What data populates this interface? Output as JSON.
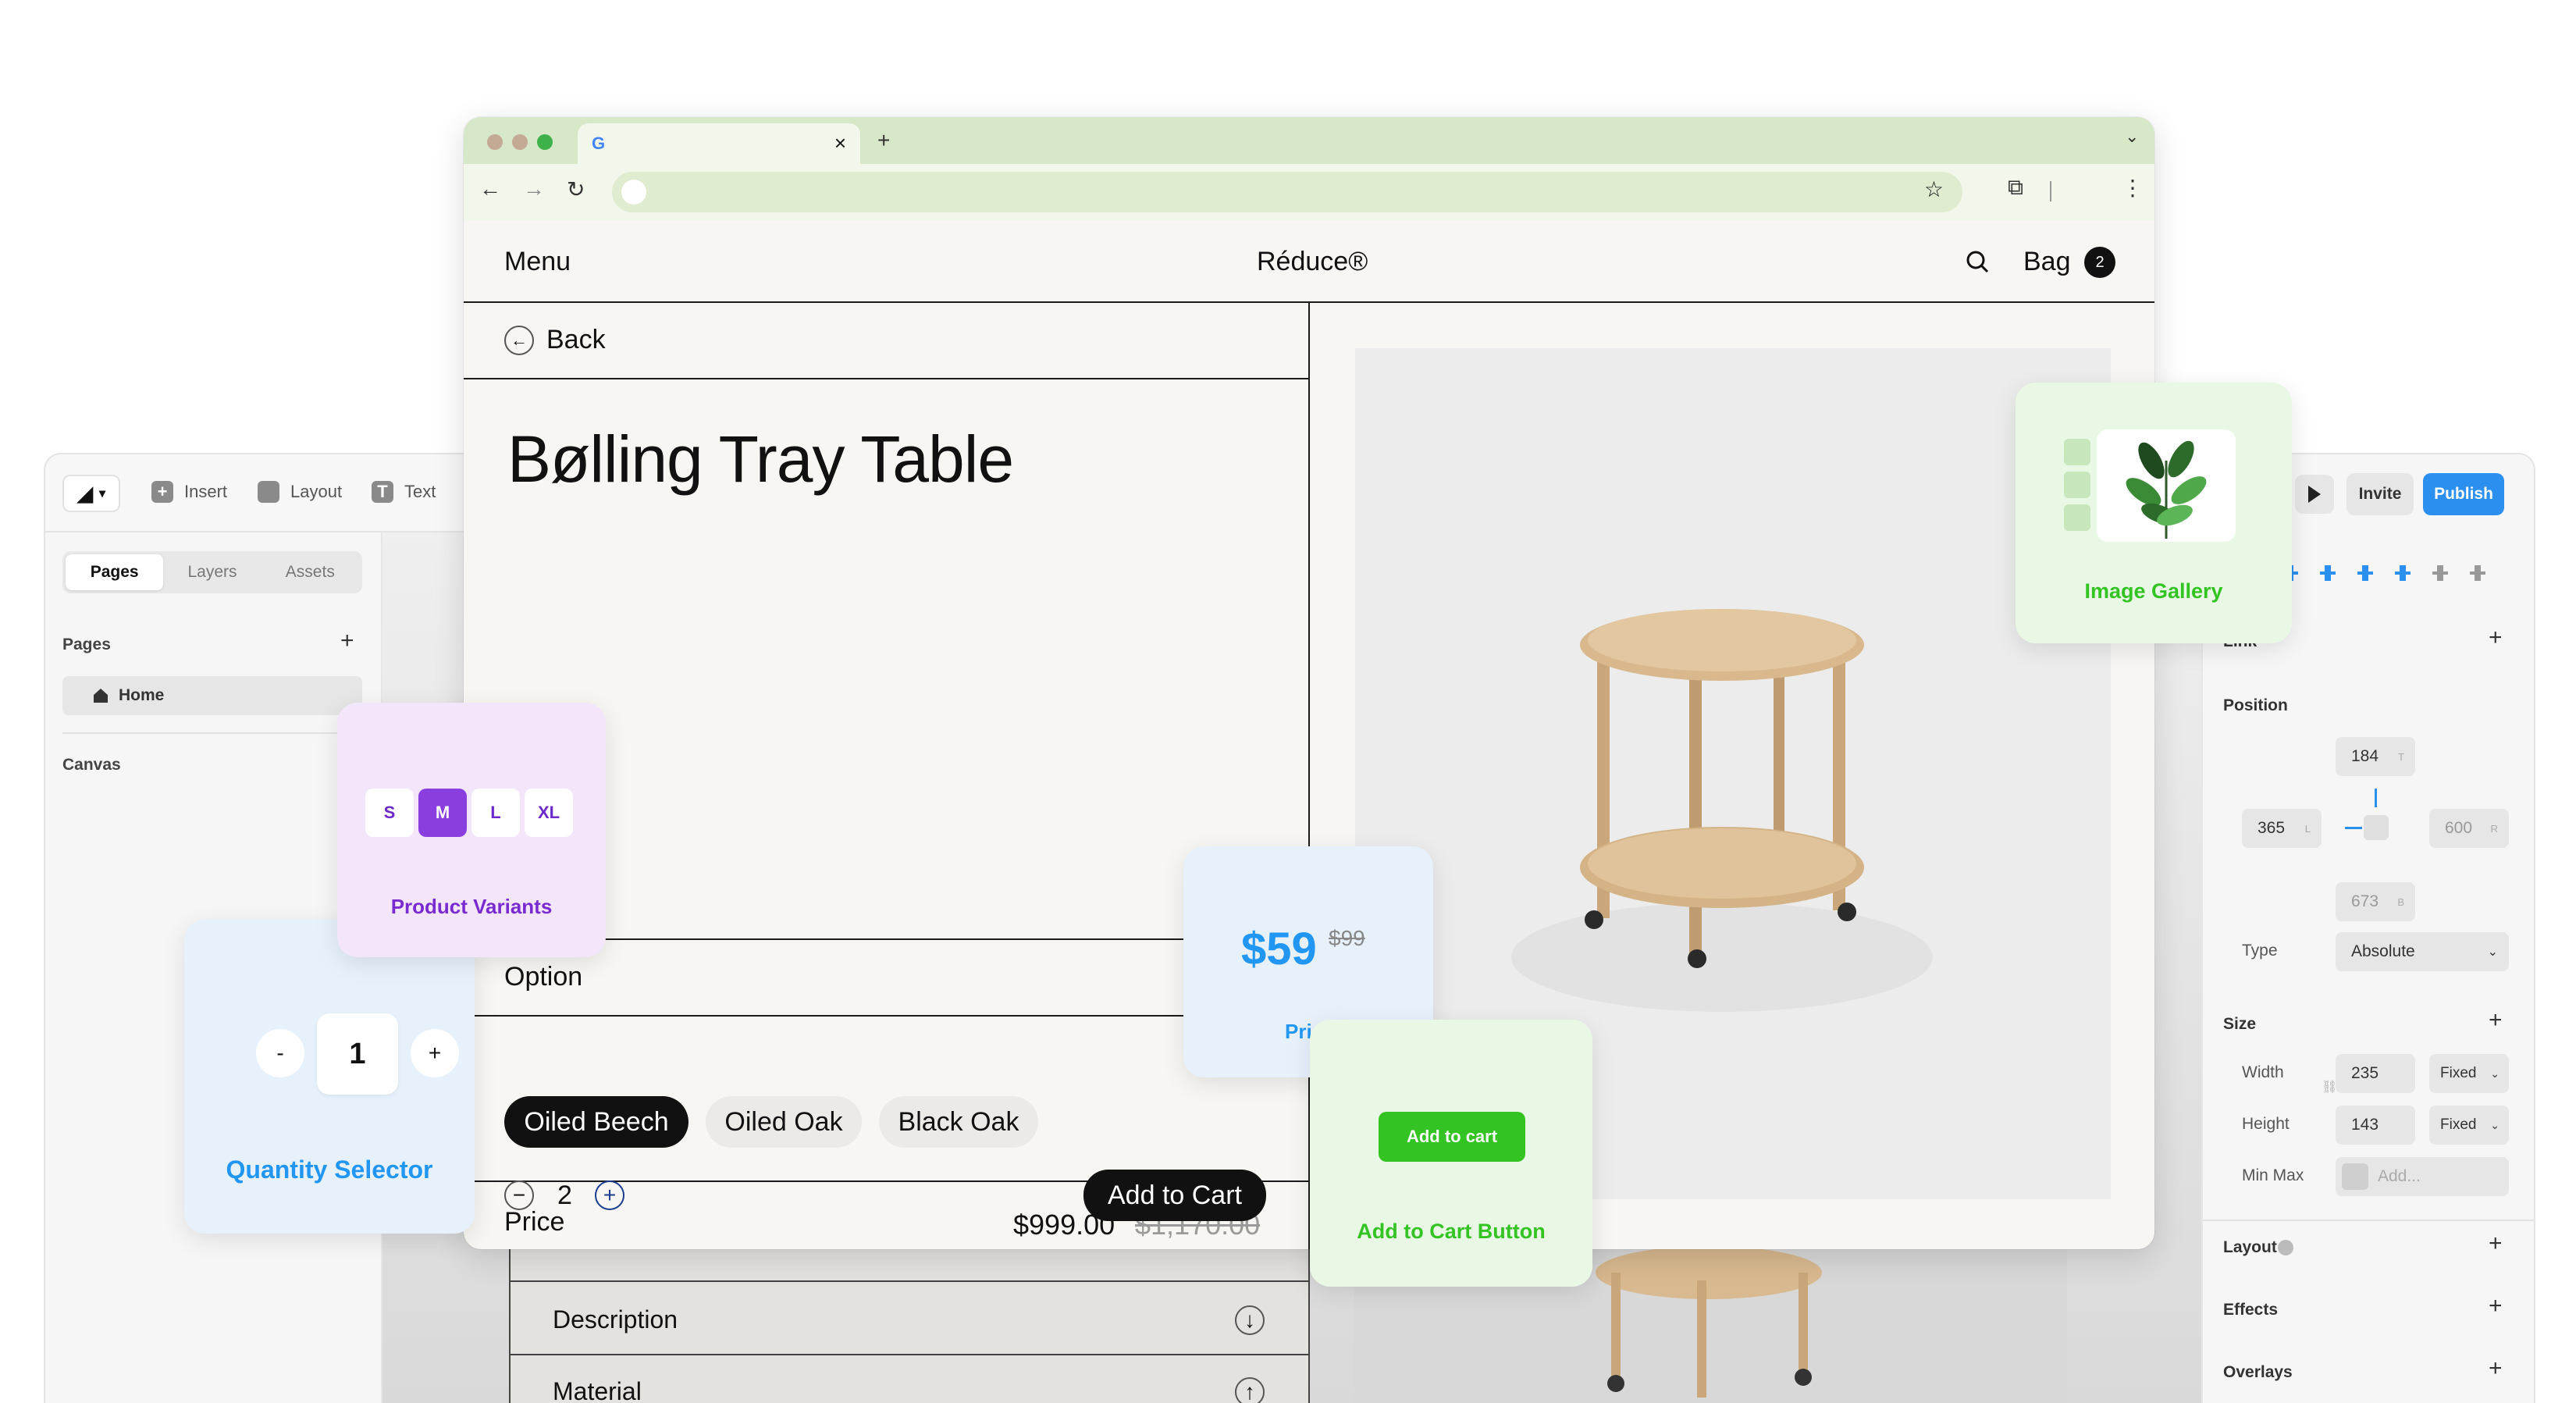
{
  "colors": {
    "accent_blue": "#2196f3",
    "accent_green": "#33c322",
    "accent_purple": "#8a3ee0",
    "chrome_green": "#d7e8c9"
  },
  "editor": {
    "toolbar": {
      "logo_icon": "framer-logo-icon",
      "insert": "Insert",
      "layout": "Layout",
      "text": "Text",
      "invite": "Invite",
      "publish": "Publish"
    },
    "tabs": [
      "Pages",
      "Layers",
      "Assets"
    ],
    "pages_label": "Pages",
    "page_home": "Home",
    "canvas_label": "Canvas",
    "right": {
      "link": "Link",
      "position": "Position",
      "pos_top": "184",
      "pos_left": "365",
      "pos_right": "600",
      "pos_bottom": "673",
      "pos_top_letter": "T",
      "pos_left_letter": "L",
      "pos_right_letter": "R",
      "pos_bottom_letter": "B",
      "type_label": "Type",
      "type_value": "Absolute",
      "size": "Size",
      "width_label": "Width",
      "width_value": "235",
      "width_mode": "Fixed",
      "height_label": "Height",
      "height_value": "143",
      "height_mode": "Fixed",
      "minmax_label": "Min Max",
      "minmax_placeholder": "Add...",
      "layout": "Layout",
      "effects": "Effects",
      "overlays": "Overlays"
    }
  },
  "browser": {
    "tab_icon": "google-g-icon",
    "url": "",
    "site": {
      "menu": "Menu",
      "brand": "Réduce®",
      "bag": "Bag",
      "bag_count": "2",
      "back": "Back",
      "title": "Bølling Tray Table",
      "section_label": "Option",
      "finishes": [
        "Oiled Beech",
        "Oiled Oak",
        "Black Oak"
      ],
      "price_label": "Price",
      "price": "$999.00",
      "price_old": "$1,170.00",
      "quantity": "2",
      "add_to_cart": "Add to Cart",
      "description": "Description",
      "material": "Material"
    }
  },
  "cards": {
    "variants": {
      "sizes": [
        "S",
        "M",
        "L",
        "XL"
      ],
      "selected": "M",
      "label": "Product Variants"
    },
    "quantity": {
      "minus": "-",
      "value": "1",
      "plus": "+",
      "label": "Quantity Selector"
    },
    "price": {
      "price": "$59",
      "old_price": "$99",
      "label": "Price"
    },
    "cart": {
      "button": "Add to cart",
      "label": "Add to Cart Button"
    },
    "gallery": {
      "label": "Image Gallery"
    }
  }
}
